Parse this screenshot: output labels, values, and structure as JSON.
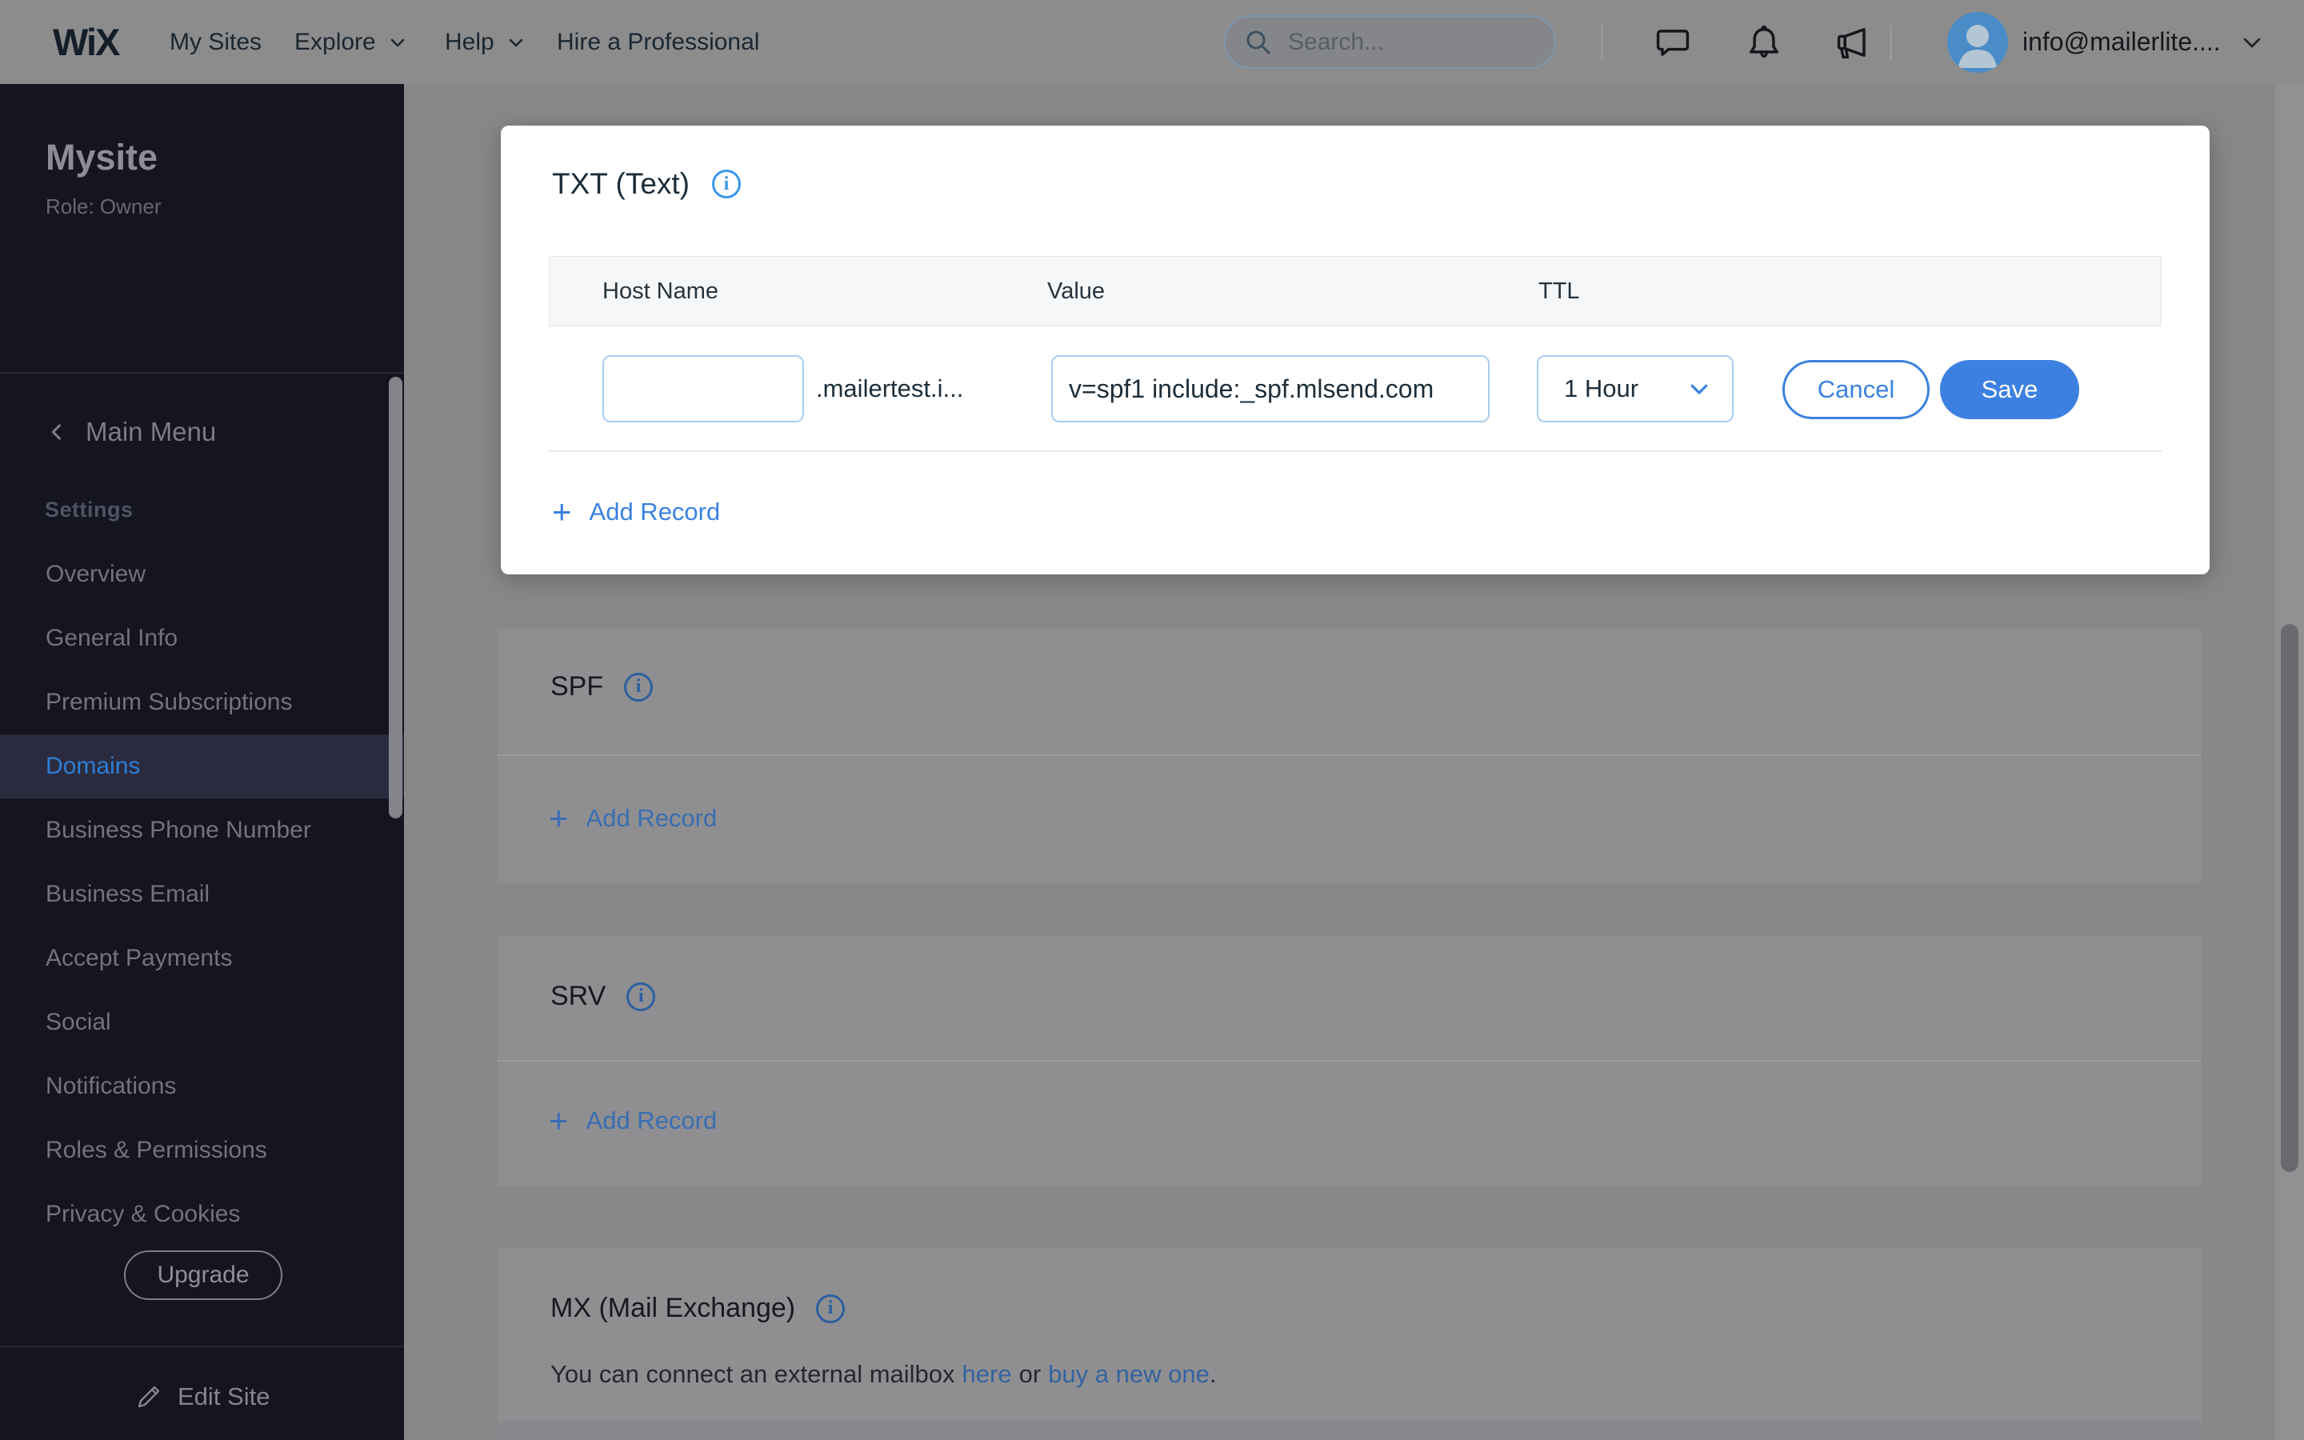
{
  "header": {
    "logo": "WiX",
    "nav": {
      "my_sites": "My Sites",
      "explore": "Explore",
      "help": "Help",
      "hire": "Hire a Professional"
    },
    "search_placeholder": "Search...",
    "account_email": "info@mailerlite...."
  },
  "sidebar": {
    "site_name": "Mysite",
    "role": "Role: Owner",
    "back_label": "Main Menu",
    "section_label": "Settings",
    "items": [
      "Overview",
      "General Info",
      "Premium Subscriptions",
      "Domains",
      "Business Phone Number",
      "Business Email",
      "Accept Payments",
      "Social",
      "Notifications",
      "Roles & Permissions",
      "Privacy & Cookies"
    ],
    "active_item": "Domains",
    "upgrade_label": "Upgrade",
    "edit_site_label": "Edit Site"
  },
  "dns": {
    "txt": {
      "title": "TXT (Text)",
      "columns": {
        "host": "Host Name",
        "value": "Value",
        "ttl": "TTL"
      },
      "row": {
        "host": "",
        "host_suffix": ".mailertest.i...",
        "value": "v=spf1 include:_spf.mlsend.com",
        "ttl": "1 Hour"
      },
      "cancel_label": "Cancel",
      "save_label": "Save",
      "add_record_label": "Add Record"
    },
    "spf": {
      "title": "SPF",
      "add_record_label": "Add Record"
    },
    "srv": {
      "title": "SRV",
      "add_record_label": "Add Record"
    },
    "mx": {
      "title": "MX (Mail Exchange)",
      "body_prefix": "You can connect an external mailbox",
      "link_here": "here",
      "body_or": "or",
      "link_buy": "buy a new one",
      "body_end": "."
    }
  },
  "colors": {
    "accent_blue": "#3b82e0",
    "info_blue": "#3899ec",
    "sidebar_active_blue": "#2e7ed4",
    "save_button_bg": "#3c80e2",
    "dim_overlay_gray": "#88888b"
  }
}
